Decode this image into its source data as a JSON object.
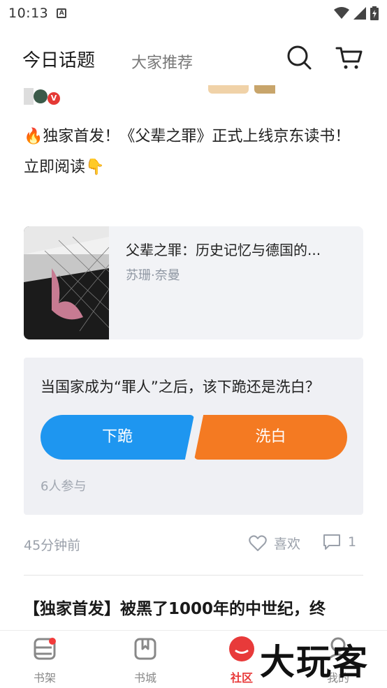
{
  "status_bar": {
    "time": "10:13",
    "notification_icon": "A"
  },
  "header": {
    "tab_active": "今日话题",
    "tab_inactive": "大家推荐",
    "search_icon": "search-icon",
    "cart_icon": "cart-icon"
  },
  "post": {
    "verified_badge": "V",
    "text_line1": "🔥独家首发！《父辈之罪》正式上线京东读书！",
    "text_line2": "立即阅读👇",
    "book": {
      "title": "父辈之罪：历史记忆与德国的...",
      "author": "苏珊·奈曼"
    },
    "poll": {
      "question": "当国家成为“罪人”之后，该下跪还是洗白？",
      "option_left": "下跪",
      "option_right": "洗白",
      "participants": "6人参与",
      "colors": {
        "left": "#1e96f0",
        "right": "#f47a22"
      }
    },
    "meta": {
      "time": "45分钟前",
      "like_label": "喜欢",
      "comment_count": "1"
    }
  },
  "next_post": {
    "title": "【独家首发】被黑了1000年的中世纪，终"
  },
  "bottom_nav": [
    {
      "label": "书架",
      "icon": "bookshelf-icon",
      "has_badge": true
    },
    {
      "label": "书城",
      "icon": "bookstore-icon"
    },
    {
      "label": "社区",
      "icon": "community-icon",
      "active": true
    },
    {
      "label": "我的",
      "icon": "profile-icon"
    }
  ],
  "watermark": "大玩客"
}
